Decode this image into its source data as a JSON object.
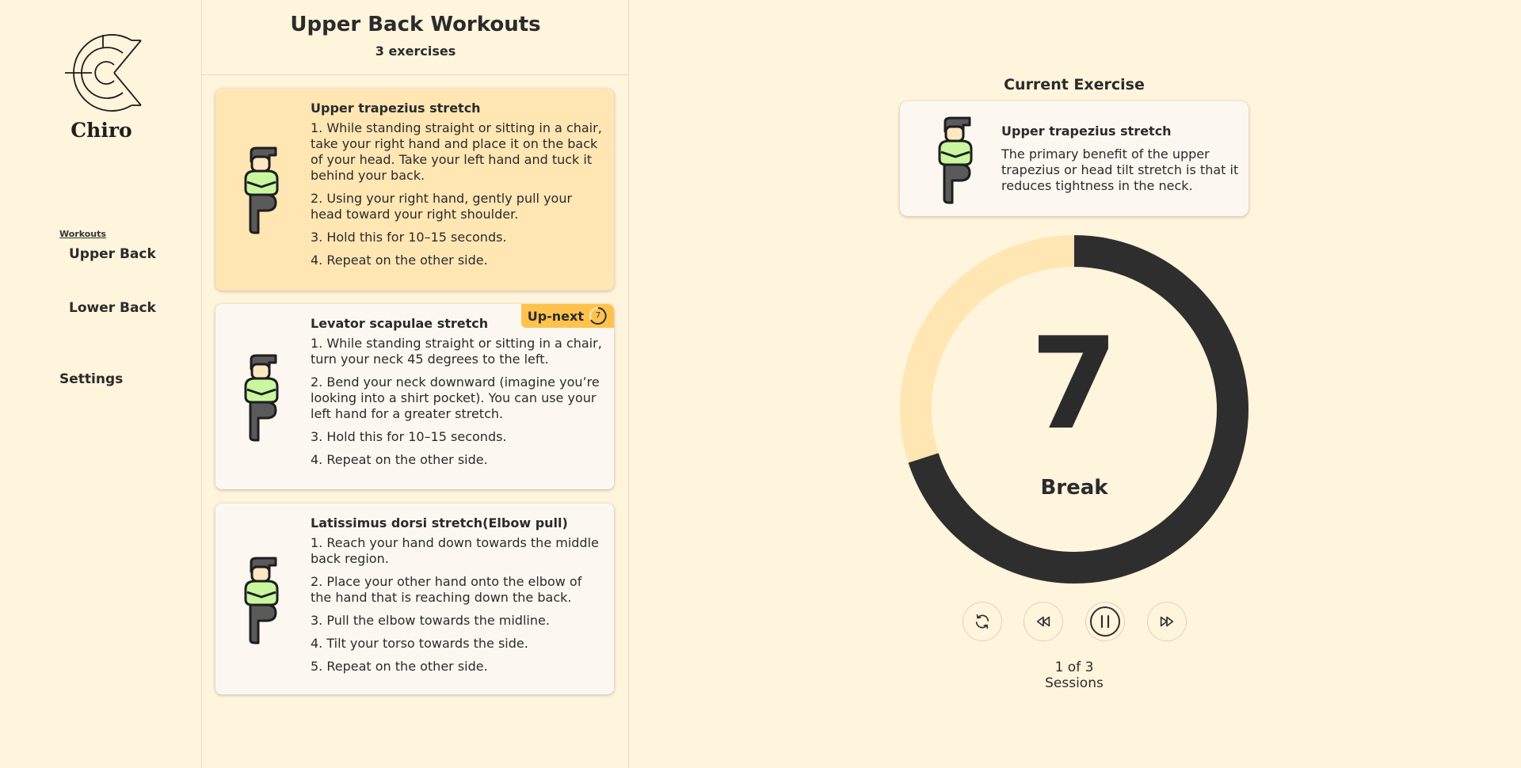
{
  "app": {
    "logo_text": "Chiro",
    "nav_section_label": "Workouts",
    "nav_items": [
      "Upper Back",
      "Lower Back"
    ],
    "settings_label": "Settings"
  },
  "list": {
    "title": "Upper Back Workouts",
    "count": "3 exercises",
    "upnext_label": "Up-next",
    "upnext_count": "7",
    "exercises": [
      {
        "title": "Upper trapezius stretch",
        "steps": [
          "1. While standing straight or sitting in a chair, take your right hand and place it on the back of your head. Take your left hand and tuck it behind your back.",
          "2. Using your right hand, gently pull your head toward your right shoulder.",
          "3. Hold this for 10–15 seconds.",
          "4. Repeat on the other side."
        ]
      },
      {
        "title": "Levator scapulae stretch",
        "steps": [
          "1. While standing straight or sitting in a chair, turn your neck 45 degrees to the left.",
          "2. Bend your neck downward (imagine you’re looking into a shirt pocket). You can use your left hand for a greater stretch.",
          "3. Hold this for 10–15 seconds.",
          "4. Repeat on the other side."
        ]
      },
      {
        "title": "Latissimus dorsi stretch(Elbow pull)",
        "steps": [
          "1. Reach your hand down towards the middle back region.",
          "2. Place your other hand onto the elbow of the hand that is reaching down the back.",
          "3. Pull the elbow towards the midline.",
          "4. Tilt your torso towards the side.",
          "5. Repeat on the other side."
        ]
      }
    ]
  },
  "current": {
    "label": "Current Exercise",
    "title": "Upper trapezius stretch",
    "description": "The primary benefit of the upper trapezius or head tilt stretch is that it reduces tightness in the neck."
  },
  "timer": {
    "value": "7",
    "state": "Break",
    "progress_fraction": 0.7
  },
  "controls": {
    "icons": [
      "restart-icon",
      "rewind-icon",
      "pause-icon",
      "fast-forward-icon"
    ]
  },
  "sessions": {
    "progress": "1 of 3",
    "label": "Sessions"
  },
  "colors": {
    "background": "#fff4dc",
    "active_card": "#ffe6b3",
    "accent": "#ffc34d",
    "dark": "#2e2e2e",
    "figure_shirt": "#c8f7a0"
  }
}
